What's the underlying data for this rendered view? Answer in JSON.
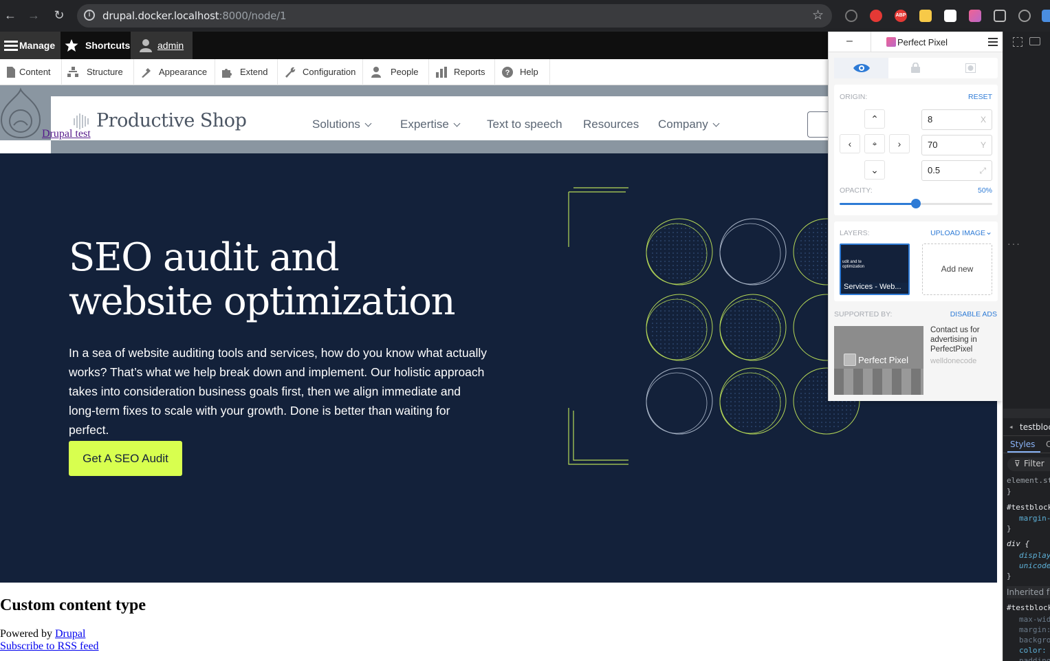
{
  "browser": {
    "url_host": "drupal.docker.localhost",
    "url_rest": ":8000/node/1"
  },
  "toolbar": {
    "manage": "Manage",
    "shortcuts": "Shortcuts",
    "user": "admin",
    "tray": [
      "Content",
      "Structure",
      "Appearance",
      "Extend",
      "Configuration",
      "People",
      "Reports",
      "Help"
    ]
  },
  "site": {
    "brand": "Productive Shop",
    "drupal_link": "Drupal test",
    "nav": [
      "Solutions",
      "Expertise",
      "Text to speech",
      "Resources",
      "Company"
    ]
  },
  "hero": {
    "title_line1": "SEO audit and",
    "title_line2": "website optimization",
    "body": "In a sea of website auditing tools and services, how do you know what actually works? That’s what we help break down and implement. Our holistic approach takes into consideration business goals first, then we align immediate and long-term fixes to scale with your growth. Done is better than waiting for perfect.",
    "cta": "Get A SEO Audit"
  },
  "footer": {
    "heading": "Custom content type",
    "powered_prefix": "Powered by ",
    "powered_link": "Drupal",
    "rss": "Subscribe to RSS feed"
  },
  "perfect_pixel": {
    "minimize": "–",
    "title": "Perfect Pixel",
    "origin_label": "ORIGIN:",
    "reset": "RESET",
    "x_value": "8",
    "x_suffix": "X",
    "y_value": "70",
    "y_suffix": "Y",
    "scale_value": "0.5",
    "opacity_label": "OPACITY:",
    "opacity_text": "50%",
    "opacity": 0.5,
    "layers_label": "LAYERS:",
    "upload": "UPLOAD IMAGE",
    "layer_caption": "Services - Web...",
    "layer_thumb_text": "udit and te optimization",
    "add_new": "Add new",
    "supported_by": "SUPPORTED BY:",
    "disable_ads": "DISABLE ADS",
    "ad_brand": "Perfect Pixel",
    "ad_text": "Contact us for advertising in PerfectPixel",
    "ad_sub": "welldonecode"
  },
  "devtools": {
    "crumb": "testbloc",
    "tab": "Styles",
    "tab2": "C",
    "filter": "Filter",
    "dots": "...",
    "lines": [
      "element.st",
      "}",
      "#testblock",
      "margin-",
      "}",
      "div {",
      "display",
      "unicode",
      "}",
      "Inherited fr",
      "#testblock",
      "max-wid",
      "margin:",
      "backgro",
      "color:",
      "padding"
    ]
  },
  "colors": {
    "hero_bg": "#13213a",
    "cta_bg": "#d8ff4f",
    "accent_blue": "#2e7bd6",
    "deco_green": "#b6d957"
  }
}
